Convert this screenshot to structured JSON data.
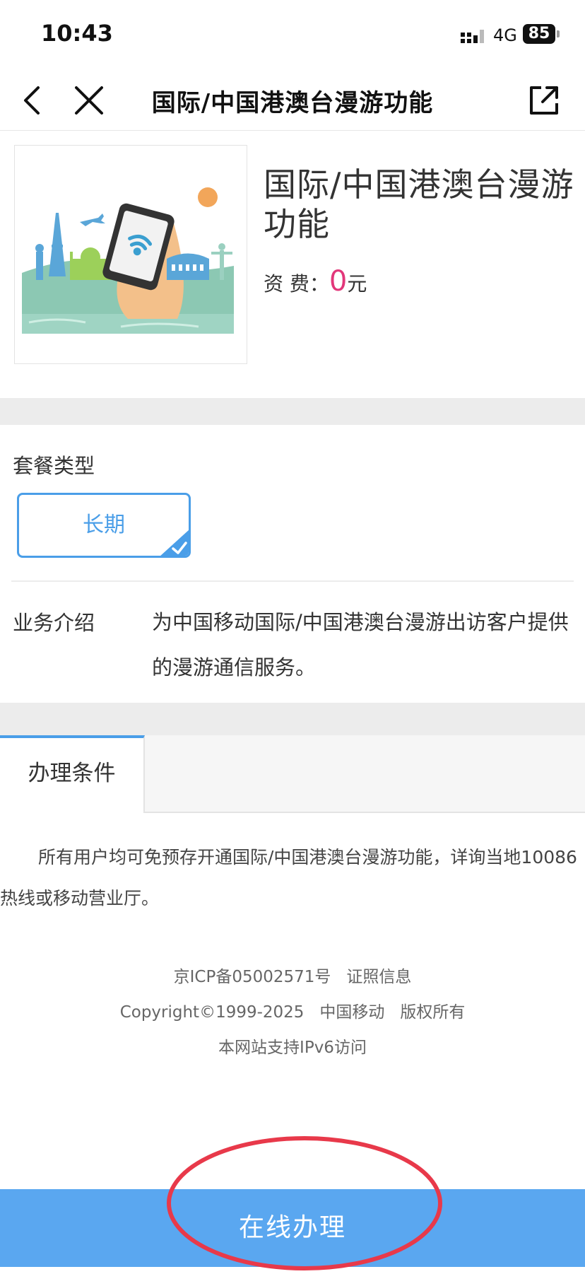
{
  "status_bar": {
    "time": "10:43",
    "network": "4G",
    "battery": "85"
  },
  "nav": {
    "title": "国际/中国港澳台漫游功能",
    "back_icon": "chevron-left-icon",
    "close_icon": "close-icon",
    "share_icon": "share-icon"
  },
  "product": {
    "title": "国际/中国港澳台漫游功能",
    "price_label": "资 费：",
    "price_value": "0",
    "price_unit": "元"
  },
  "package": {
    "label": "套餐类型",
    "options": [
      {
        "label": "长期",
        "selected": true
      }
    ]
  },
  "intro": {
    "label": "业务介绍",
    "text": "为中国移动国际/中国港澳台漫游出访客户提供的漫游通信服务。"
  },
  "tabs": [
    {
      "label": "办理条件",
      "active": true
    }
  ],
  "conditions": {
    "text": "所有用户均可免预存开通国际/中国港澳台漫游功能，详询当地10086热线或移动营业厅。"
  },
  "footer": {
    "icp": "京ICP备05002571号",
    "license": "证照信息",
    "copyright_prefix": "Copyright©1999-2025",
    "company": "中国移动",
    "rights": "版权所有",
    "ipv6": "本网站支持IPv6访问"
  },
  "cta": {
    "label": "在线办理"
  },
  "colors": {
    "accent": "#4a9ee8",
    "cta_bg": "#5aa7f0",
    "price": "#e2377a",
    "annotation": "#e8394a"
  }
}
